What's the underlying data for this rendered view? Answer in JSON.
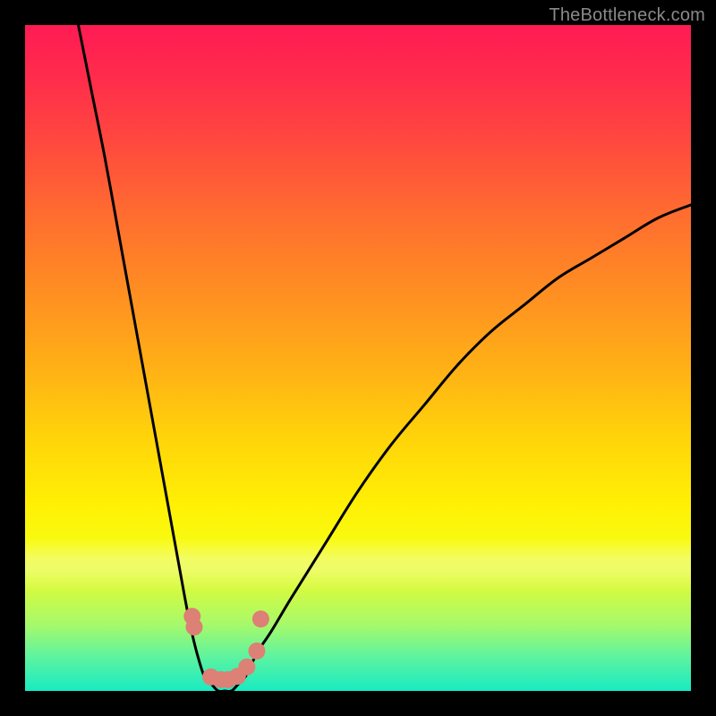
{
  "watermark": "TheBottleneck.com",
  "colors": {
    "curve_stroke": "#000000",
    "marker_fill": "#dd8076",
    "marker_stroke": "#dd8076",
    "frame": "#000000"
  },
  "chart_data": {
    "type": "line",
    "title": "",
    "xlabel": "",
    "ylabel": "",
    "xlim": [
      0,
      100
    ],
    "ylim": [
      0,
      100
    ],
    "note": "No axes, tick labels, or legend are visible. Curve values are estimated from pixel geometry.",
    "series": [
      {
        "name": "left-curve",
        "x": [
          8,
          10,
          12,
          14,
          16,
          18,
          20,
          22,
          24,
          25,
          26,
          27,
          28,
          29,
          30
        ],
        "y": [
          100,
          90,
          80,
          69,
          58,
          47,
          36,
          25,
          14,
          9,
          5,
          2,
          1,
          0,
          0
        ]
      },
      {
        "name": "right-curve",
        "x": [
          30,
          31,
          32,
          33,
          34,
          35,
          37,
          40,
          45,
          50,
          55,
          60,
          65,
          70,
          75,
          80,
          85,
          90,
          95,
          100
        ],
        "y": [
          0,
          0,
          1,
          2,
          4,
          6,
          9,
          14,
          22,
          30,
          37,
          43,
          49,
          54,
          58,
          62,
          65,
          68,
          71,
          73
        ]
      }
    ],
    "markers": [
      {
        "x": 25.1,
        "y": 11.2
      },
      {
        "x": 25.4,
        "y": 9.6
      },
      {
        "x": 27.9,
        "y": 2.1
      },
      {
        "x": 29.4,
        "y": 1.7
      },
      {
        "x": 30.5,
        "y": 1.7
      },
      {
        "x": 31.9,
        "y": 2.2
      },
      {
        "x": 33.3,
        "y": 3.6
      },
      {
        "x": 34.8,
        "y": 6.0
      },
      {
        "x": 35.4,
        "y": 10.8
      }
    ]
  }
}
